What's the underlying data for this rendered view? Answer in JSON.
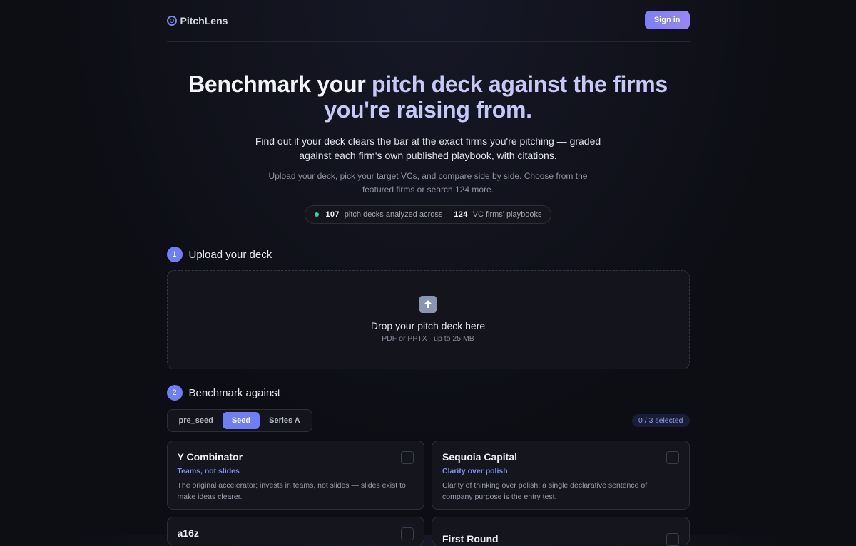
{
  "brand": {
    "name": "PitchLens"
  },
  "header": {
    "signin_label": "Sign in"
  },
  "hero": {
    "title_w1": "Benchmark your ",
    "title_g1": "pitch deck against the firms",
    "title_g2": "you're raising from.",
    "subtitle": "Find out if your deck clears the bar at the exact firms you're pitching — graded against each firm's own published playbook, with citations.",
    "description": "Upload your deck, pick your target VCs, and compare side by side. Choose from the featured firms or search 124 more."
  },
  "stats": {
    "decks": "107",
    "decks_text": "pitch decks analyzed across",
    "firms": "124",
    "firms_text": "VC firms' playbooks"
  },
  "step1": {
    "number": "1",
    "title": "Upload your deck"
  },
  "dropzone": {
    "title": "Drop your pitch deck here",
    "subtitle": "PDF or PPTX · up to 25 MB"
  },
  "step2": {
    "number": "2",
    "title": "Benchmark against"
  },
  "stages": {
    "tabs": [
      "pre_seed",
      "Seed",
      "Series A"
    ],
    "active": "Seed"
  },
  "selection": {
    "label": "0 / 3 selected"
  },
  "firms": [
    {
      "name": "Y Combinator",
      "tag": "Teams, not slides",
      "desc": "The original accelerator; invests in teams, not slides — slides exist to make ideas clearer."
    },
    {
      "name": "Sequoia Capital",
      "tag": "Clarity over polish",
      "desc": "Clarity of thinking over polish; a single declarative sentence of company purpose is the entry test."
    },
    {
      "name": "a16z"
    },
    {
      "name": "First Round"
    }
  ]
}
